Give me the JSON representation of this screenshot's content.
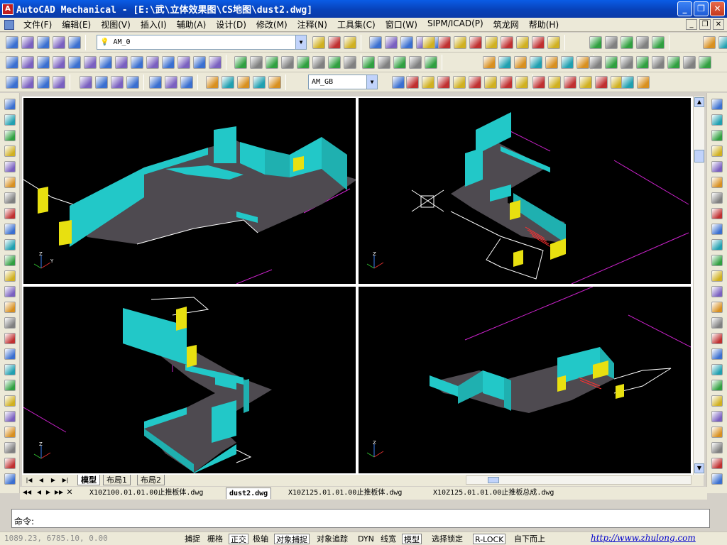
{
  "window": {
    "title": "AutoCAD Mechanical - [E:\\武\\立体效果图\\CS地图\\dust2.dwg]"
  },
  "menu": [
    "文件(F)",
    "编辑(E)",
    "视图(V)",
    "插入(I)",
    "辅助(A)",
    "设计(D)",
    "修改(M)",
    "注释(N)",
    "工具集(C)",
    "窗口(W)",
    "SIPM/ICAD(P)",
    "筑龙网",
    "帮助(H)"
  ],
  "toolbar": {
    "layer_combo": "AM_0",
    "dimstyle_combo": "AM_GB"
  },
  "layout_tabs": [
    "模型",
    "布局1",
    "布局2"
  ],
  "doc_tabs": [
    "X10Z100.01.01.00止推板体.dwg",
    "dust2.dwg",
    "X10Z125.01.01.00止推板体.dwg",
    "X10Z125.01.01.00止推板总成.dwg"
  ],
  "command": {
    "prompt": "命令:"
  },
  "status": {
    "coords": "1089.23, 6785.10, 0.00",
    "toggles": [
      {
        "label": "捕捉",
        "on": false
      },
      {
        "label": "栅格",
        "on": false
      },
      {
        "label": "正交",
        "on": true
      },
      {
        "label": "极轴",
        "on": false
      },
      {
        "label": "对象捕捉",
        "on": true
      },
      {
        "label": "对象追踪",
        "on": false
      },
      {
        "label": "DYN",
        "on": false
      },
      {
        "label": "线宽",
        "on": false
      },
      {
        "label": "模型",
        "on": true
      }
    ],
    "extras": [
      "选择锁定",
      "R-LOCK",
      "自下而上"
    ],
    "link": "http://www.zhulong.com"
  },
  "ucs": {
    "x": "X",
    "y": "Y",
    "z": "Z"
  },
  "colors": {
    "wall": "#22c8c8",
    "floor": "#4e4a50",
    "block": "#e8e010",
    "trace": "#cc22cc",
    "edge": "#ffffff",
    "stair": "#ff3030"
  }
}
